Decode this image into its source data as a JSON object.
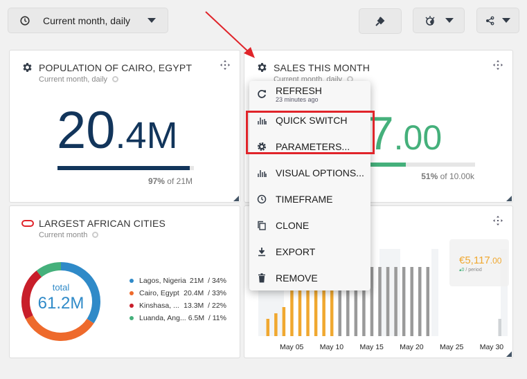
{
  "toolbar": {
    "timeframe_label": "Current month, daily",
    "icons": [
      "clock-icon",
      "plug-icon",
      "theme-icon",
      "share-icon"
    ]
  },
  "colors": {
    "navy": "#12355b",
    "green": "#45b07b",
    "orange": "#f0a830",
    "gray_bar": "#9a9a9a",
    "highlight_red": "#e0242a"
  },
  "panels": {
    "cairo": {
      "title": "POPULATION OF CAIRO, EGYPT",
      "subtitle": "Current month, daily",
      "value_int": "20",
      "value_dec": ".4M",
      "progress_percent": 97,
      "progress_pct_label": "97%",
      "progress_of": " of 21M"
    },
    "sales": {
      "title": "SALES THIS MONTH",
      "subtitle": "Current month, daily",
      "value_int": "17",
      "value_dec": ".00",
      "progress_percent": 51,
      "progress_pct_label": "51%",
      "progress_of": " of 10.00k"
    },
    "cities": {
      "title": "LARGEST AFRICAN CITIES",
      "subtitle": "Current month",
      "center_label": "total",
      "center_value": "61.2M"
    },
    "daily": {
      "tooltip_value": "€5,117",
      "tooltip_dec": ".00",
      "tooltip_change": "▴0",
      "tooltip_period": " / period"
    }
  },
  "menu": {
    "items": [
      {
        "label": "REFRESH",
        "sub": "23 minutes ago",
        "icon": "refresh-icon"
      },
      {
        "label": "QUICK SWITCH",
        "icon": "bar-chart-icon"
      },
      {
        "label": "PARAMETERS...",
        "icon": "gear-icon"
      },
      {
        "label": "VISUAL OPTIONS...",
        "icon": "bar-chart-icon"
      },
      {
        "label": "TIMEFRAME",
        "icon": "clock-icon"
      },
      {
        "label": "CLONE",
        "icon": "copy-icon"
      },
      {
        "label": "EXPORT",
        "icon": "download-icon"
      },
      {
        "label": "REMOVE",
        "icon": "trash-icon"
      }
    ]
  },
  "chart_data": [
    {
      "type": "pie",
      "title": "LARGEST AFRICAN CITIES",
      "categories": [
        "Lagos, Nigeria",
        "Cairo, Egypt",
        "Kinshasa, ...",
        "Luanda, Ang..."
      ],
      "values": [
        21,
        20.4,
        13.3,
        6.5
      ],
      "value_labels": [
        "21M",
        "20.4M",
        "13.3M",
        "6.5M"
      ],
      "percent_labels": [
        "34%",
        "33%",
        "22%",
        "11%"
      ],
      "colors": [
        "#2f8ac8",
        "#ee6a2c",
        "#c81e2a",
        "#45b07b"
      ],
      "legend": "right"
    },
    {
      "type": "bar",
      "x_ticks": [
        "May 05",
        "May 10",
        "May 15",
        "May 20",
        "May 25",
        "May 30"
      ],
      "days": [
        2,
        3,
        4,
        5,
        6,
        7,
        8,
        9,
        10,
        11,
        12,
        13,
        14,
        15,
        16,
        17,
        18,
        19,
        20,
        21,
        22,
        31
      ],
      "values": [
        25,
        33,
        42,
        100,
        100,
        100,
        100,
        100,
        100,
        100,
        100,
        100,
        100,
        100,
        100,
        100,
        100,
        100,
        100,
        100,
        100,
        25
      ],
      "colors_note_days_orange": [
        2,
        10
      ],
      "grid": false
    }
  ]
}
